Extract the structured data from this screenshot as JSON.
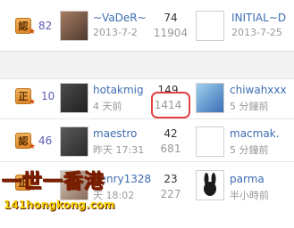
{
  "rows": [
    {
      "badge": "認",
      "count": "82",
      "name": "~VaDeR~",
      "date": "2013-7-2",
      "replies": "74",
      "views": "11904",
      "right_name": "INITIAL~D",
      "right_time": "2013-7-25"
    },
    {
      "badge": "正",
      "count": "10",
      "name": "hotakmig",
      "date": "4 天前",
      "replies": "149",
      "views": "1414",
      "right_name": "chiwahxxx",
      "right_time": "5 分鐘前"
    },
    {
      "badge": "認",
      "count": "46",
      "name": "maestro",
      "date": "昨天 17:31",
      "replies": "42",
      "views": "681",
      "right_name": "macmak.",
      "right_time": "5 分鐘前"
    },
    {
      "badge": "正",
      "count": "",
      "name": "henry1328",
      "date": "天 18:02",
      "replies": "23",
      "views": "227",
      "right_name": "parma",
      "right_time": "半小時前"
    }
  ],
  "watermark": {
    "title": "一世一香港",
    "url": "141hongkong.com"
  }
}
